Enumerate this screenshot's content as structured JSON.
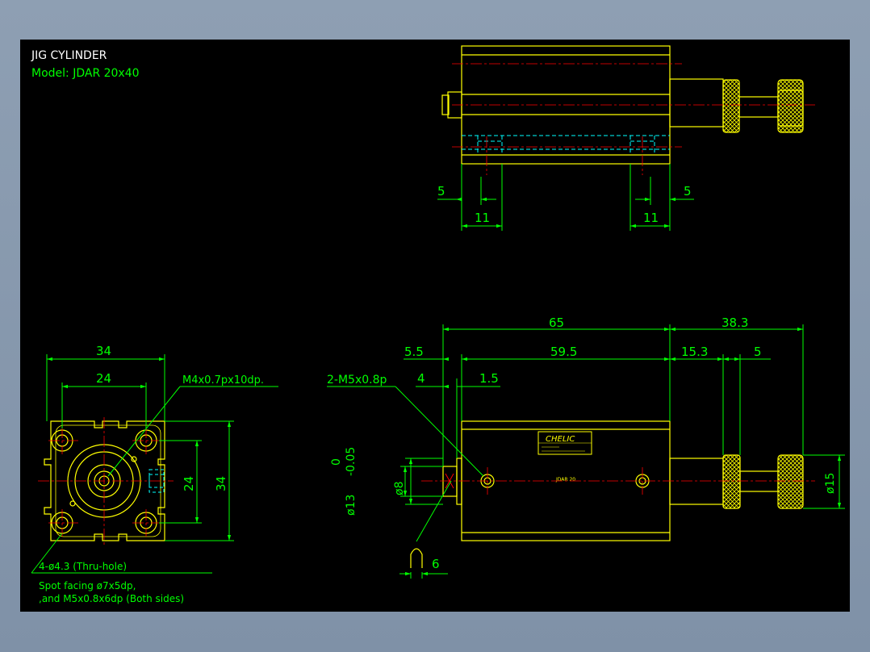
{
  "title": {
    "line1": "JIG CYLINDER",
    "line2": "Model:  JDAR 20x40"
  },
  "colors": {
    "background": "#000000",
    "frame": "#8a9bb0",
    "part": "#ffff00",
    "dimension": "#00ff00",
    "centerline": "#ff0000",
    "hidden": "#00ffff",
    "title": "#ffffff"
  },
  "top_view": {
    "dims": [
      "5",
      "5",
      "11",
      "11"
    ]
  },
  "side_view": {
    "dims": {
      "overall": "65",
      "rod_ext": "38.3",
      "body": "59.5",
      "left_gap": "5.5",
      "knurl": "15.3",
      "nut": "5",
      "port_off": "4",
      "port_step": "1.5",
      "pin": "6"
    },
    "callout_port": "2-M5x0.8p",
    "bore_tol_upper": "0",
    "bore_tol_lower": "-0.05",
    "bore": "ø13",
    "boss": "ø8",
    "rod_dia": "ø15",
    "label_brand": "CHELIC",
    "label_model": "JDAR 20"
  },
  "end_view": {
    "dim_width": "34",
    "dim_pitch_h": "24",
    "dim_pitch_v": "24",
    "dim_height": "34",
    "callout_thread": "M4x0.7px10dp.",
    "callout_holes": "4-ø4.3 (Thru-hole)",
    "note_line1": "Spot facing ø7x5dp,",
    "note_line2": ",and M5x0.8x6dp (Both sides)"
  }
}
